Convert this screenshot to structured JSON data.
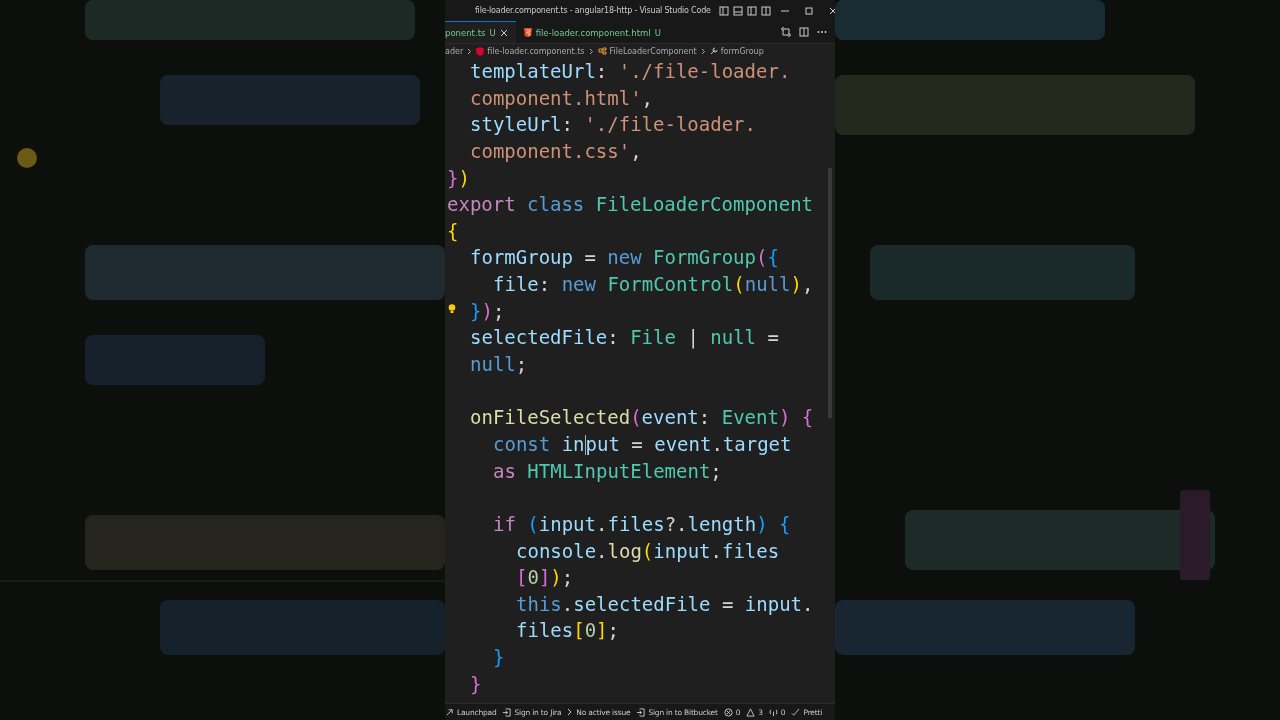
{
  "window": {
    "title": "file-loader.component.ts - angular18-http - Visual Studio Code"
  },
  "tabs": [
    {
      "label": "ponent.ts",
      "status": "U",
      "selected": true,
      "kind": "ts"
    },
    {
      "label": "file-loader.component.html",
      "status": "U",
      "selected": false,
      "kind": "html"
    }
  ],
  "breadcrumbs": [
    {
      "label": "ader",
      "kind": "folder"
    },
    {
      "label": "file-loader.component.ts",
      "kind": "angular"
    },
    {
      "label": "FileLoaderComponent",
      "kind": "class"
    },
    {
      "label": "formGroup",
      "kind": "field"
    }
  ],
  "code_lines": [
    {
      "kind": "member",
      "tokens": [
        {
          "t": "templateUrl",
          "kind": "prop"
        },
        {
          "t": ": ",
          "kind": "punct"
        },
        {
          "t": "'./file-loader.",
          "kind": "string"
        }
      ]
    },
    {
      "kind": "member",
      "tokens": [
        {
          "t": "component.html'",
          "kind": "string"
        },
        {
          "t": ",",
          "kind": "punct"
        }
      ]
    },
    {
      "kind": "member",
      "tokens": [
        {
          "t": "styleUrl",
          "kind": "prop"
        },
        {
          "t": ": ",
          "kind": "punct"
        },
        {
          "t": "'./file-loader.",
          "kind": "string"
        }
      ]
    },
    {
      "kind": "member",
      "tokens": [
        {
          "t": "component.css'",
          "kind": "string"
        },
        {
          "t": ",",
          "kind": "punct"
        }
      ]
    },
    {
      "kind": "top",
      "tokens": [
        {
          "t": "}",
          "kind": "brace2"
        },
        {
          "t": ")",
          "kind": "brace1"
        }
      ]
    },
    {
      "kind": "top",
      "tokens": [
        {
          "t": "export ",
          "kind": "control"
        },
        {
          "t": "class ",
          "kind": "keyword"
        },
        {
          "t": "FileLoaderComponent",
          "kind": "type"
        }
      ]
    },
    {
      "kind": "top",
      "tokens": [
        {
          "t": "{",
          "kind": "brace1"
        }
      ]
    },
    {
      "kind": "member",
      "tokens": [
        {
          "t": "formGroup",
          "kind": "prop"
        },
        {
          "t": " = ",
          "kind": "punct"
        },
        {
          "t": "new ",
          "kind": "keyword"
        },
        {
          "t": "FormGroup",
          "kind": "type"
        },
        {
          "t": "(",
          "kind": "brace2"
        },
        {
          "t": "{",
          "kind": "brace3"
        }
      ]
    },
    {
      "kind": "body",
      "tokens": [
        {
          "t": "file",
          "kind": "prop"
        },
        {
          "t": ": ",
          "kind": "punct"
        },
        {
          "t": "new ",
          "kind": "keyword"
        },
        {
          "t": "FormControl",
          "kind": "type"
        },
        {
          "t": "(",
          "kind": "brace1"
        },
        {
          "t": "null",
          "kind": "keyword"
        },
        {
          "t": ")",
          "kind": "brace1"
        },
        {
          "t": ",",
          "kind": "punct"
        }
      ]
    },
    {
      "kind": "member",
      "tokens": [
        {
          "t": "}",
          "kind": "brace3"
        },
        {
          "t": ")",
          "kind": "brace2"
        },
        {
          "t": ";",
          "kind": "punct"
        }
      ],
      "lightbulb": true
    },
    {
      "kind": "member",
      "tokens": [
        {
          "t": "selectedFile",
          "kind": "prop"
        },
        {
          "t": ": ",
          "kind": "punct"
        },
        {
          "t": "File",
          "kind": "type"
        },
        {
          "t": " | ",
          "kind": "punct"
        },
        {
          "t": "null",
          "kind": "type"
        },
        {
          "t": " =",
          "kind": "punct"
        }
      ]
    },
    {
      "kind": "member",
      "tokens": [
        {
          "t": "null",
          "kind": "keyword"
        },
        {
          "t": ";",
          "kind": "punct"
        }
      ]
    },
    {
      "kind": "blank"
    },
    {
      "kind": "member",
      "tokens": [
        {
          "t": "onFileSelected",
          "kind": "func"
        },
        {
          "t": "(",
          "kind": "brace2"
        },
        {
          "t": "event",
          "kind": "prop"
        },
        {
          "t": ": ",
          "kind": "punct"
        },
        {
          "t": "Event",
          "kind": "type"
        },
        {
          "t": ") ",
          "kind": "brace2"
        },
        {
          "t": "{",
          "kind": "brace2"
        }
      ]
    },
    {
      "kind": "body",
      "tokens": [
        {
          "t": "const ",
          "kind": "keyword"
        },
        {
          "t": "in",
          "kind": "var"
        },
        {
          "t": "put",
          "kind": "var"
        },
        {
          "t": " = ",
          "kind": "punct"
        },
        {
          "t": "event",
          "kind": "prop"
        },
        {
          "t": ".",
          "kind": "punct"
        },
        {
          "t": "target",
          "kind": "var"
        }
      ],
      "cursor": true
    },
    {
      "kind": "body",
      "tokens": [
        {
          "t": "as ",
          "kind": "control"
        },
        {
          "t": "HTMLInputElement",
          "kind": "type"
        },
        {
          "t": ";",
          "kind": "punct"
        }
      ]
    },
    {
      "kind": "blank"
    },
    {
      "kind": "body",
      "tokens": [
        {
          "t": "if ",
          "kind": "control"
        },
        {
          "t": "(",
          "kind": "brace3"
        },
        {
          "t": "input",
          "kind": "var"
        },
        {
          "t": ".",
          "kind": "punct"
        },
        {
          "t": "files",
          "kind": "prop"
        },
        {
          "t": "?.",
          "kind": "punct"
        },
        {
          "t": "length",
          "kind": "var"
        },
        {
          "t": ") ",
          "kind": "brace3"
        },
        {
          "t": "{",
          "kind": "brace3"
        }
      ]
    },
    {
      "kind": "block",
      "tokens": [
        {
          "t": "console",
          "kind": "prop"
        },
        {
          "t": ".",
          "kind": "punct"
        },
        {
          "t": "log",
          "kind": "func"
        },
        {
          "t": "(",
          "kind": "brace1"
        },
        {
          "t": "input",
          "kind": "var"
        },
        {
          "t": ".",
          "kind": "punct"
        },
        {
          "t": "files",
          "kind": "prop"
        }
      ]
    },
    {
      "kind": "block",
      "tokens": [
        {
          "t": "[",
          "kind": "brace2"
        },
        {
          "t": "0",
          "kind": "number"
        },
        {
          "t": "]",
          "kind": "brace2"
        },
        {
          "t": ")",
          "kind": "brace1"
        },
        {
          "t": ";",
          "kind": "punct"
        }
      ]
    },
    {
      "kind": "block",
      "tokens": [
        {
          "t": "this",
          "kind": "keyword"
        },
        {
          "t": ".",
          "kind": "punct"
        },
        {
          "t": "selectedFile",
          "kind": "prop"
        },
        {
          "t": " = ",
          "kind": "punct"
        },
        {
          "t": "input",
          "kind": "var"
        },
        {
          "t": ".",
          "kind": "punct"
        }
      ]
    },
    {
      "kind": "block",
      "tokens": [
        {
          "t": "files",
          "kind": "prop"
        },
        {
          "t": "[",
          "kind": "brace1"
        },
        {
          "t": "0",
          "kind": "number"
        },
        {
          "t": "]",
          "kind": "brace1"
        },
        {
          "t": ";",
          "kind": "punct"
        }
      ]
    },
    {
      "kind": "body",
      "tokens": [
        {
          "t": "}",
          "kind": "brace3"
        }
      ]
    },
    {
      "kind": "member",
      "tokens": [
        {
          "t": "}",
          "kind": "brace2"
        }
      ]
    }
  ],
  "status_bar": [
    {
      "kind": "launch",
      "text": "Launchpad"
    },
    {
      "kind": "signin",
      "text": "Sign in to Jira"
    },
    {
      "kind": "chevron",
      "text": "No active issue"
    },
    {
      "kind": "signin",
      "text": "Sign in to Bitbucket"
    },
    {
      "kind": "error",
      "text": "0"
    },
    {
      "kind": "warning",
      "text": "3"
    },
    {
      "kind": "ports",
      "text": "0"
    },
    {
      "kind": "check",
      "text": "Pretti"
    }
  ]
}
